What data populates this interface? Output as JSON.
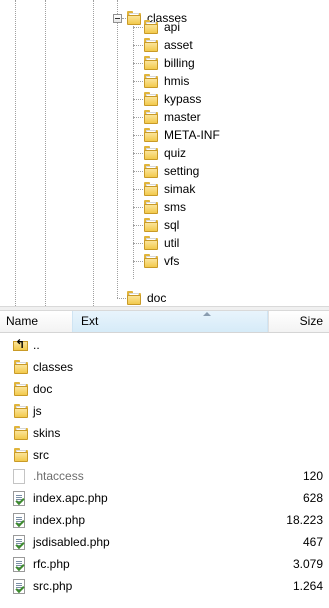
{
  "tree": {
    "root": {
      "label": "classes",
      "icon": "folder-icon",
      "expanded": true
    },
    "children": [
      {
        "label": "api",
        "icon": "folder-icon"
      },
      {
        "label": "asset",
        "icon": "folder-icon"
      },
      {
        "label": "billing",
        "icon": "folder-icon"
      },
      {
        "label": "hmis",
        "icon": "folder-icon"
      },
      {
        "label": "kypass",
        "icon": "folder-icon"
      },
      {
        "label": "master",
        "icon": "folder-icon"
      },
      {
        "label": "META-INF",
        "icon": "folder-icon"
      },
      {
        "label": "quiz",
        "icon": "folder-icon"
      },
      {
        "label": "setting",
        "icon": "folder-icon"
      },
      {
        "label": "simak",
        "icon": "folder-icon"
      },
      {
        "label": "sms",
        "icon": "folder-icon"
      },
      {
        "label": "sql",
        "icon": "folder-icon"
      },
      {
        "label": "util",
        "icon": "folder-icon"
      },
      {
        "label": "vfs",
        "icon": "folder-icon"
      }
    ],
    "sibling": {
      "label": "doc",
      "icon": "folder-icon"
    }
  },
  "list": {
    "columns": {
      "name": "Name",
      "ext": "Ext",
      "size": "Size"
    },
    "sort_indicator": "sort-ascending-icon",
    "rows": [
      {
        "name": "..",
        "size": "",
        "icon": "up-folder-icon"
      },
      {
        "name": "classes",
        "size": "",
        "icon": "folder-icon"
      },
      {
        "name": "doc",
        "size": "",
        "icon": "folder-icon"
      },
      {
        "name": "js",
        "size": "",
        "icon": "folder-icon"
      },
      {
        "name": "skins",
        "size": "",
        "icon": "folder-icon"
      },
      {
        "name": "src",
        "size": "",
        "icon": "folder-icon"
      },
      {
        "name": ".htaccess",
        "size": "120",
        "icon": "blank-file-icon"
      },
      {
        "name": "index.apc.php",
        "size": "628",
        "icon": "php-file-icon"
      },
      {
        "name": "index.php",
        "size": "18.223",
        "icon": "php-file-icon"
      },
      {
        "name": "jsdisabled.php",
        "size": "467",
        "icon": "php-file-icon"
      },
      {
        "name": "rfc.php",
        "size": "3.079",
        "icon": "php-file-icon"
      },
      {
        "name": "src.php",
        "size": "1.264",
        "icon": "php-file-icon"
      }
    ]
  }
}
